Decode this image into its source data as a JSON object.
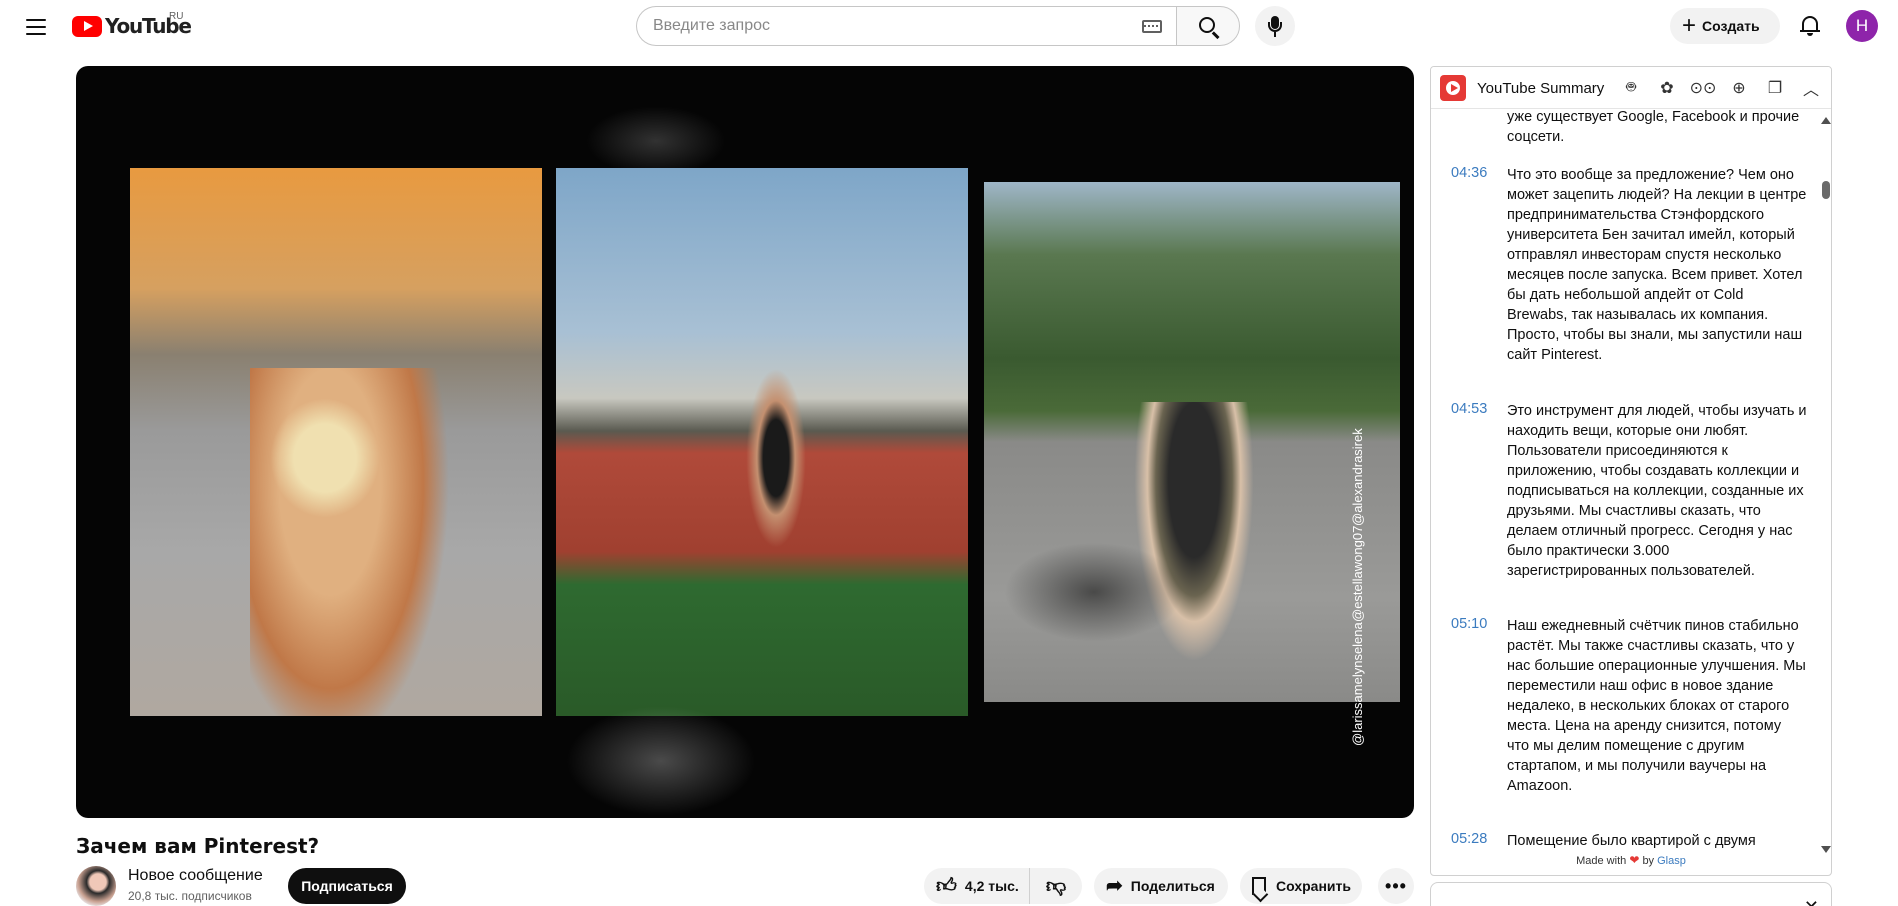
{
  "header": {
    "logo_text": "YouTube",
    "country_code": "RU",
    "search_placeholder": "Введите запрос",
    "create_label": "Создать",
    "avatar_letter": "Н"
  },
  "video": {
    "title": "Зачем вам Pinterest?",
    "channel_name": "Новое сообщение",
    "subscribers": "20,8 тыс. подписчиков",
    "subscribe_label": "Подписаться",
    "likes": "4,2 тыс.",
    "share_label": "Поделиться",
    "save_label": "Сохранить",
    "watermark": [
      "@alexandrasirek",
      "@estellawong07",
      "@larissamelynselena"
    ]
  },
  "summary": {
    "title": "YouTube Summary",
    "transcript": [
      {
        "time": "",
        "text": "уже существует Google, Facebook и прочие соцсети."
      },
      {
        "time": "04:36",
        "text": "Что это вообще за предложение? Чем оно может зацепить людей? На лекции в центре предпринимательства Стэнфордского университета Бен зачитал имейл, который отправлял инвесторам спустя несколько месяцев после запуска. Всем привет. Хотел бы дать небольшой апдейт от Cold Brewabs, так называлась их компания. Просто, чтобы вы знали, мы запустили наш сайт Pinterest."
      },
      {
        "time": "04:53",
        "text": "Это инструмент для людей, чтобы изучать и находить вещи, которые они любят. Пользователи присоединяются к приложению, чтобы создавать коллекции и подписываться на коллекции, созданные их друзьями. Мы счастливы сказать, что делаем отличный прогресс. Сегодня у нас было практически 3.000 зарегистрированных пользователей."
      },
      {
        "time": "05:10",
        "text": "Наш ежедневный счётчик пинов стабильно растёт. Мы также счастливы сказать, что у нас большие операционные улучшения. Мы переместили наш офис в новое здание недалеко, в нескольких блоках от старого места. Цена на аренду снизится, потому что мы делим помещение с другим стартапом, и мы получили ваучеры на Amazoon."
      },
      {
        "time": "05:28",
        "text": "Помещение было квартирой с двумя спальнями, где ютились вместе две"
      }
    ],
    "footer_made_with": "Made with",
    "footer_by": "by",
    "footer_brand": "Glasp"
  }
}
